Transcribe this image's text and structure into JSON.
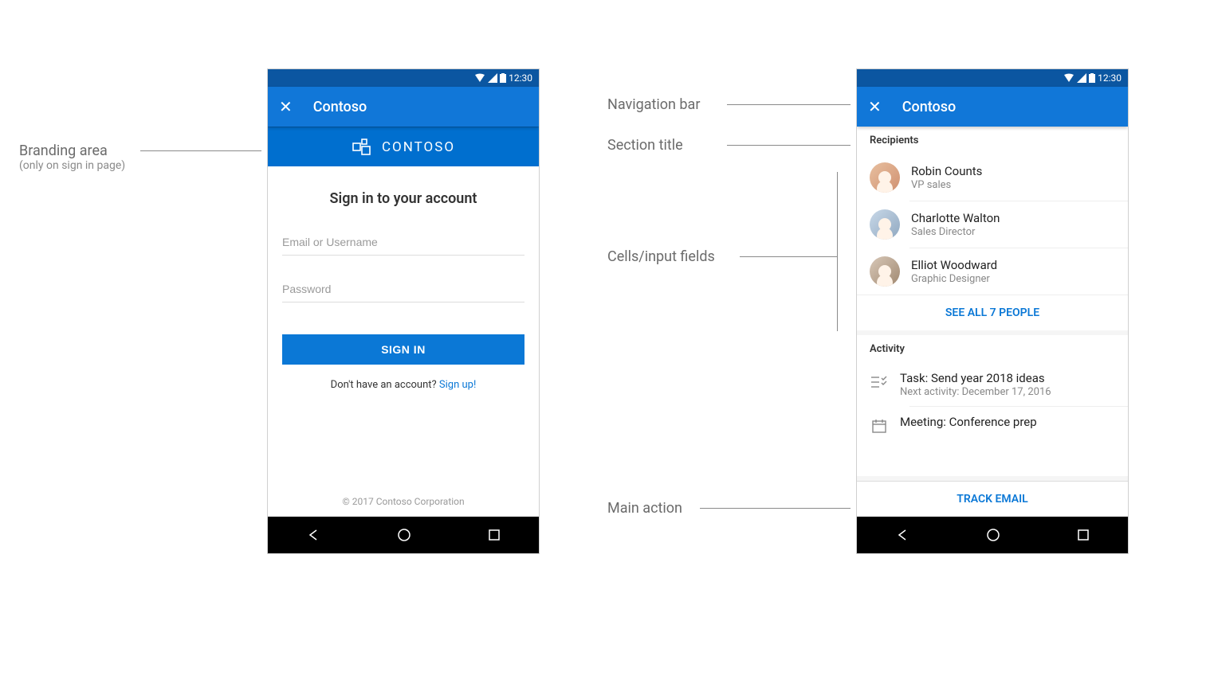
{
  "annotations": {
    "branding_area": "Branding area",
    "branding_area_sub": "(only on sign in page)",
    "navigation_bar": "Navigation bar",
    "section_title": "Section title",
    "cells_input": "Cells/input fields",
    "main_action": "Main action"
  },
  "common": {
    "status_time": "12:30",
    "app_title": "Contoso"
  },
  "signin": {
    "brand_label": "CONTOSO",
    "heading": "Sign in to your account",
    "email_placeholder": "Email or Username",
    "password_placeholder": "Password",
    "signin_button": "SIGN IN",
    "no_account_text": "Don't have an account? ",
    "signup_link": "Sign up!",
    "copyright": "© 2017 Contoso Corporation"
  },
  "recipients": {
    "section_label": "Recipients",
    "people": [
      {
        "name": "Robin Counts",
        "role": "VP sales"
      },
      {
        "name": "Charlotte Walton",
        "role": "Sales Director"
      },
      {
        "name": "Elliot Woodward",
        "role": "Graphic Designer"
      }
    ],
    "see_all": "SEE ALL 7 PEOPLE"
  },
  "activity": {
    "section_label": "Activity",
    "items": [
      {
        "title": "Task: Send year 2018 ideas",
        "sub": "Next activity: December 17, 2016"
      },
      {
        "title": "Meeting: Conference prep",
        "sub": ""
      }
    ]
  },
  "main_action": "TRACK EMAIL"
}
